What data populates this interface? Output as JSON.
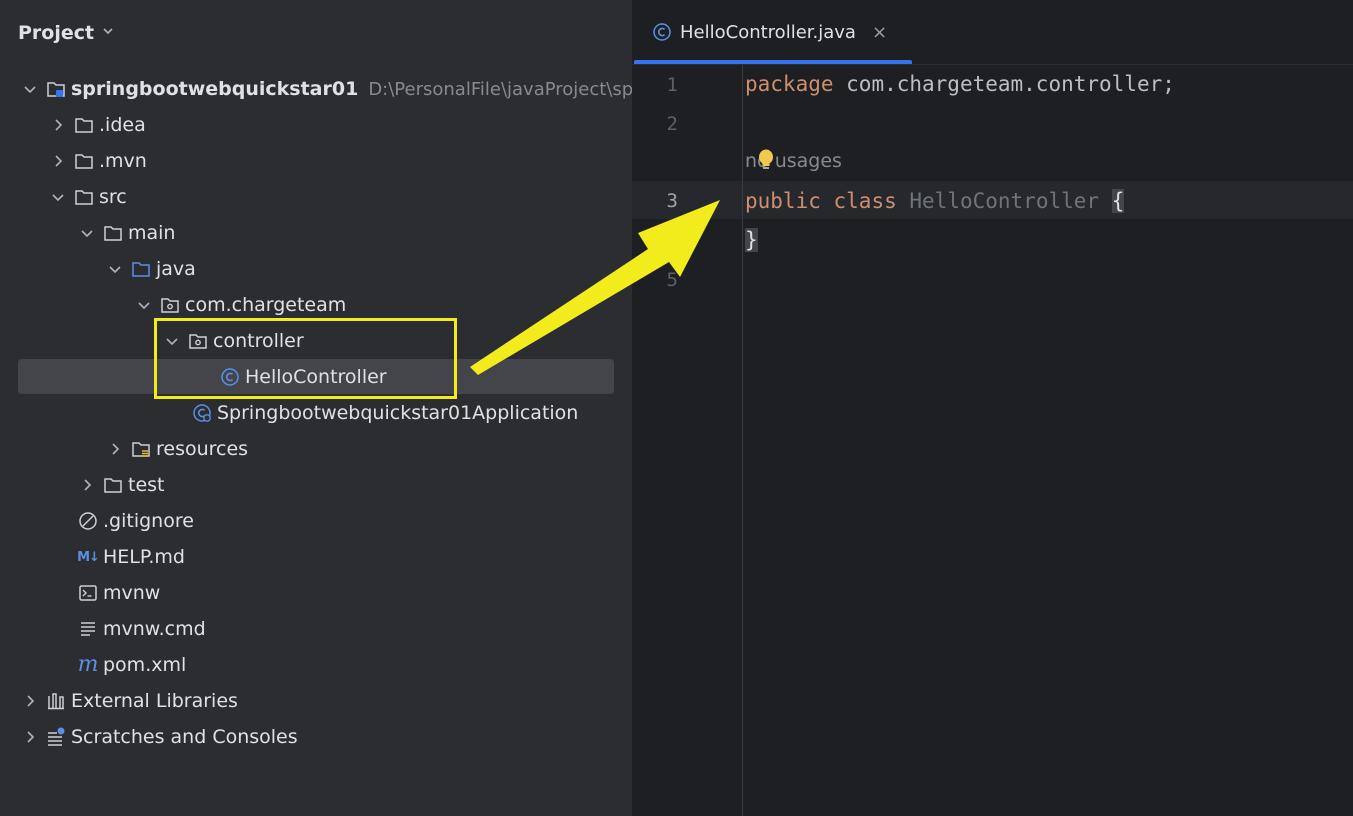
{
  "project_panel": {
    "title": "Project",
    "root": {
      "name": "springbootwebquickstar01",
      "path": "D:\\PersonalFile\\javaProject\\sp"
    },
    "items": [
      {
        "label": ".idea"
      },
      {
        "label": ".mvn"
      },
      {
        "label": "src"
      },
      {
        "label": "main"
      },
      {
        "label": "java"
      },
      {
        "label": "com.chargeteam"
      },
      {
        "label": "controller"
      },
      {
        "label": "HelloController"
      },
      {
        "label": "Springbootwebquickstar01Application"
      },
      {
        "label": "resources"
      },
      {
        "label": "test"
      },
      {
        "label": ".gitignore"
      },
      {
        "label": "HELP.md"
      },
      {
        "label": "mvnw"
      },
      {
        "label": "mvnw.cmd"
      },
      {
        "label": "pom.xml"
      },
      {
        "label": "External Libraries"
      },
      {
        "label": "Scratches and Consoles"
      }
    ],
    "badges": {
      "md": "M↓",
      "maven": "m"
    }
  },
  "editor": {
    "tab_label": "HelloController.java",
    "close_glyph": "×",
    "line_numbers": [
      "1",
      "2",
      "3",
      "5"
    ],
    "code": {
      "line1_keyword": "package",
      "line1_rest": " com.chargeteam.controller;",
      "hint": "no usages",
      "line3_kw1": "public",
      "line3_kw2": "class",
      "line3_name": "HelloController",
      "open_brace": "{",
      "close_brace": "}"
    }
  },
  "colors": {
    "highlight": "#f2ec1c",
    "accent": "#3574f0",
    "keyword": "#cf8e6d"
  }
}
